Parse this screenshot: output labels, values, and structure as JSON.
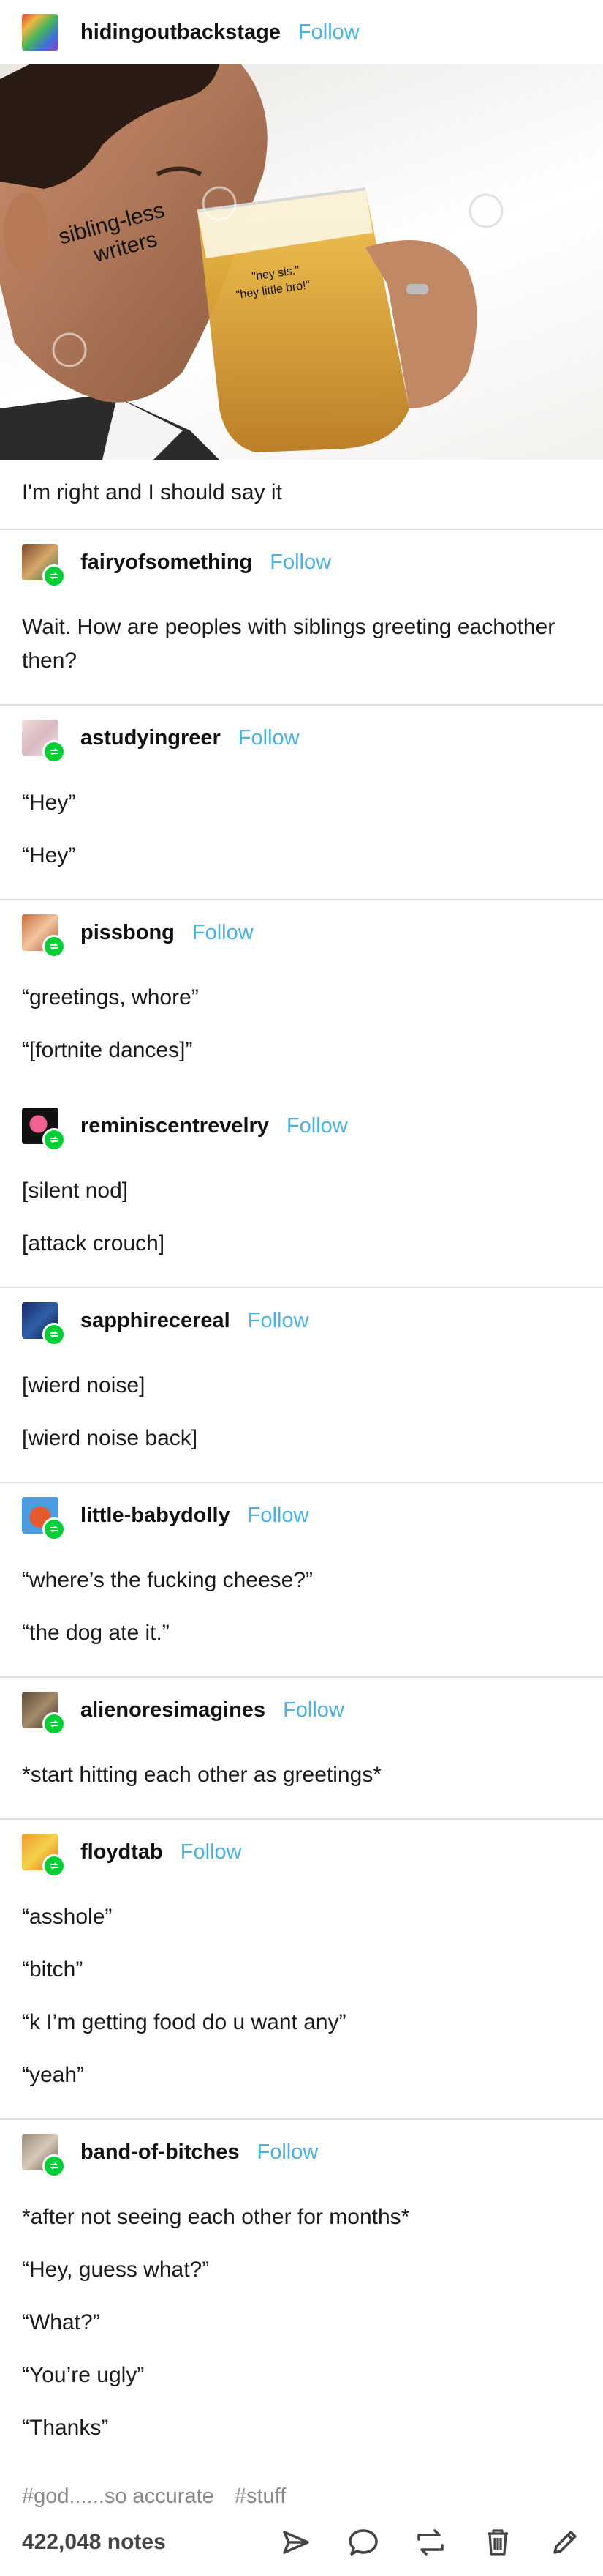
{
  "op": {
    "username": "hidingoutbackstage",
    "follow": "Follow"
  },
  "image": {
    "label_writers": "sibling-less\nwriters",
    "label_glass": "\"hey sis.\"\n\"hey little bro!\""
  },
  "op_text": "I'm right and I should say it",
  "reblogs": [
    {
      "username": "fairyofsomething",
      "follow": "Follow",
      "paragraphs": [
        "Wait. How are peoples with siblings greeting eachother then?"
      ]
    },
    {
      "username": "astudyingreer",
      "follow": "Follow",
      "paragraphs": [
        "“Hey”",
        "“Hey”"
      ]
    },
    {
      "username": "pissbong",
      "follow": "Follow",
      "paragraphs": [
        "“greetings, whore”",
        "“[fortnite dances]”"
      ]
    },
    {
      "username": "reminiscentrevelry",
      "follow": "Follow",
      "paragraphs": [
        "[silent nod]",
        "[attack crouch]"
      ]
    },
    {
      "username": "sapphirecereal",
      "follow": "Follow",
      "paragraphs": [
        "[wierd noise]",
        "[wierd noise back]"
      ]
    },
    {
      "username": "little-babydolly",
      "follow": "Follow",
      "paragraphs": [
        "“where’s the fucking cheese?”",
        "“the dog ate it.”"
      ]
    },
    {
      "username": "alienoresimagines",
      "follow": "Follow",
      "paragraphs": [
        "*start hitting each other as greetings*"
      ]
    },
    {
      "username": "floydtab",
      "follow": "Follow",
      "paragraphs": [
        "“asshole”",
        "“bitch”",
        "“k I’m getting food do u want any”",
        "“yeah”"
      ]
    },
    {
      "username": "band-of-bitches",
      "follow": "Follow",
      "paragraphs": [
        "*after not seeing each other for months*",
        "“Hey, guess what?”",
        "“What?”",
        "“You’re ugly”",
        "“Thanks”"
      ]
    }
  ],
  "tags": [
    "#god......so accurate",
    "#stuff"
  ],
  "notes": "422,048 notes",
  "footer_icons": [
    "share-icon",
    "reply-icon",
    "reblog-icon",
    "delete-icon",
    "edit-icon"
  ],
  "colors": {
    "follow": "#4ab1e0",
    "reblog_badge": "#00cf35"
  }
}
